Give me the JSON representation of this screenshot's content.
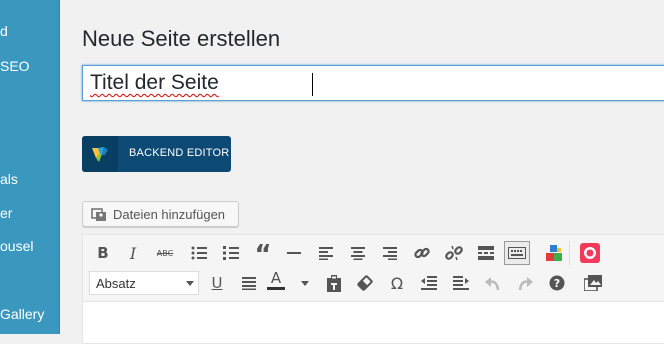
{
  "sidebar": {
    "items": [
      {
        "label": "d"
      },
      {
        "label": "SEO"
      },
      {
        "label": "als"
      },
      {
        "label": "er"
      },
      {
        "label": "ousel"
      },
      {
        "label": "Gallery"
      }
    ]
  },
  "page": {
    "title": "Neue Seite erstellen",
    "title_input_value": "Titel der Seite"
  },
  "backend_editor": {
    "label": "BACKEND EDITOR"
  },
  "media": {
    "add_label": "Dateien hinzufügen"
  },
  "toolbar": {
    "row1": [
      "bold-icon",
      "italic-icon",
      "strikethrough-icon",
      "bullet-list-icon",
      "numbered-list-icon",
      "blockquote-icon",
      "horizontal-line-icon",
      "align-left-icon",
      "align-center-icon",
      "align-right-icon",
      "link-icon",
      "unlink-icon",
      "read-more-icon",
      "keyboard-icon",
      "shortcodes-icon",
      "record-icon"
    ],
    "row2": [
      "underline-icon",
      "justify-icon",
      "text-color-icon",
      "paste-text-icon",
      "clear-format-icon",
      "special-char-icon",
      "outdent-icon",
      "indent-icon",
      "undo-icon",
      "redo-icon",
      "help-icon",
      "gallery-icon"
    ],
    "format_select": {
      "value": "Absatz"
    },
    "glyphs": {
      "bold": "B",
      "italic": "I",
      "strike": "ABC",
      "quote": "“",
      "underline": "U",
      "textcolor": "A",
      "omega": "Ω",
      "help": "?"
    }
  },
  "colors": {
    "sidebar": "#3a97bd",
    "backend_button": "#0c4a74",
    "focus_border": "#5b9dd9"
  }
}
